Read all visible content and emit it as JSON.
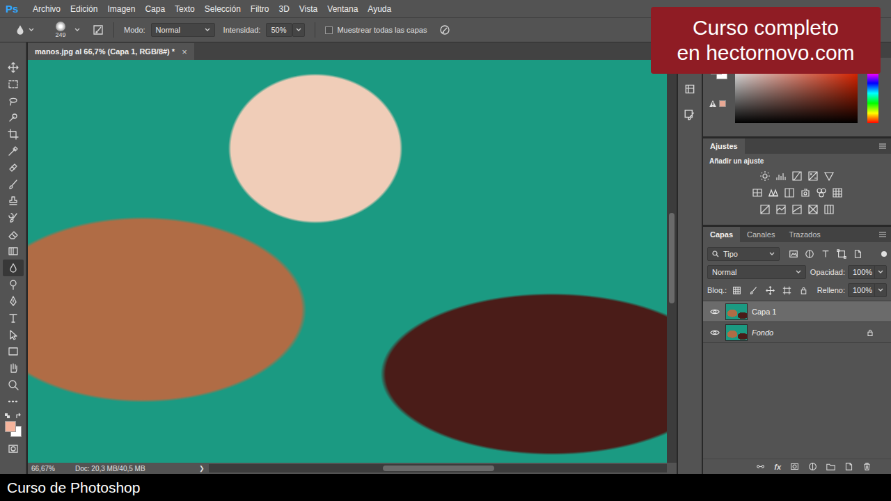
{
  "app": {
    "logo": "Ps"
  },
  "menu": [
    {
      "label": "Archivo"
    },
    {
      "label": "Edición"
    },
    {
      "label": "Imagen"
    },
    {
      "label": "Capa"
    },
    {
      "label": "Texto"
    },
    {
      "label": "Selección"
    },
    {
      "label": "Filtro"
    },
    {
      "label": "3D"
    },
    {
      "label": "Vista"
    },
    {
      "label": "Ventana"
    },
    {
      "label": "Ayuda"
    }
  ],
  "options": {
    "brush_size": "249",
    "mode_label": "Modo:",
    "mode": "Normal",
    "intensity_label": "Intensidad:",
    "intensity": "50%",
    "sample_all": {
      "label": "Muestrear todas las capas",
      "checked": false
    }
  },
  "tools": [
    {
      "selected": false
    },
    {
      "selected": false
    },
    {
      "selected": false
    },
    {
      "selected": false
    },
    {
      "selected": false
    },
    {
      "selected": false
    },
    {
      "selected": false
    },
    {
      "selected": false
    },
    {
      "selected": false
    },
    {
      "selected": false
    },
    {
      "selected": false
    },
    {
      "selected": false
    },
    {
      "selected": true
    },
    {
      "selected": false
    },
    {
      "selected": false
    },
    {
      "selected": false
    },
    {
      "selected": false
    },
    {
      "selected": false
    },
    {
      "selected": false
    },
    {
      "selected": false
    },
    {
      "selected": false
    }
  ],
  "document": {
    "tab": "manos.jpg al 66,7% (Capa 1, RGB/8#) *",
    "close": "×",
    "zoom": "66,67%",
    "doc_info": "Doc: 20,3 MB/40,5 MB",
    "status_arrow": "❯"
  },
  "adjustments": {
    "tab": "Ajustes",
    "hint": "Añadir un ajuste"
  },
  "layers_panel": {
    "tabs": [
      {
        "label": "Capas",
        "selected": true
      },
      {
        "label": "Canales",
        "selected": false
      },
      {
        "label": "Trazados",
        "selected": false
      }
    ],
    "filter": "Tipo",
    "blend_mode": "Normal",
    "opacity_label": "Opacidad:",
    "opacity": "100%",
    "lock_label": "Bloq.:",
    "fill_label": "Relleno:",
    "fill": "100%",
    "layers": [
      {
        "name": "Capa 1",
        "visible": true,
        "selected": true,
        "locked": false,
        "kind": "layer"
      },
      {
        "name": "Fondo",
        "visible": true,
        "selected": false,
        "locked": true,
        "kind": "background"
      }
    ],
    "footer_fx": "fx"
  },
  "promo": {
    "lines": [
      "Curso completo",
      "en hectornovo.com"
    ]
  },
  "caption": "Curso de Photoshop"
}
